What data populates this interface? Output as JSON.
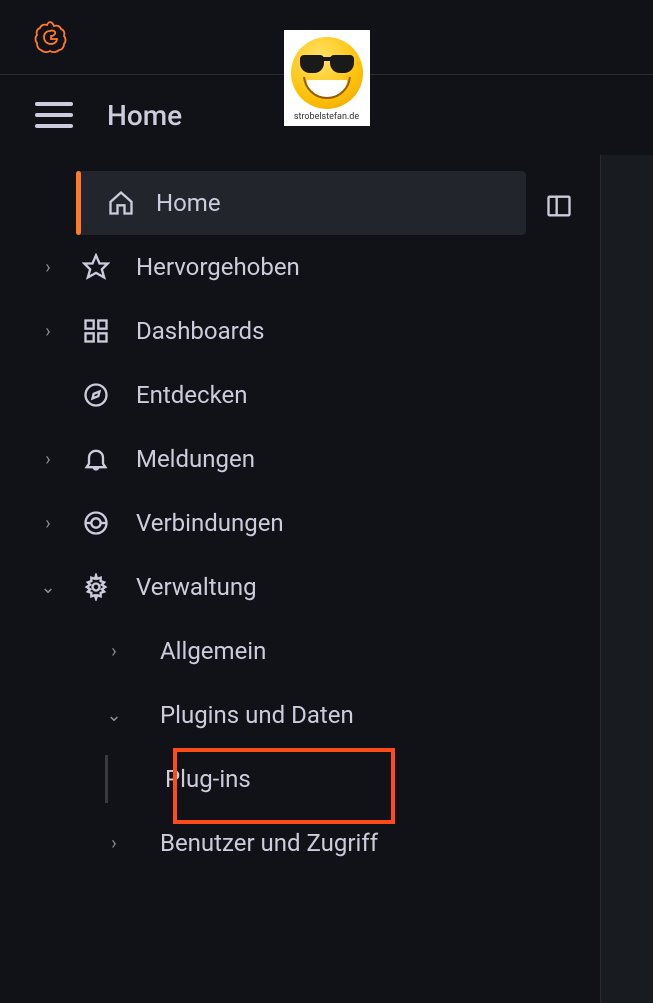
{
  "breadcrumb": {
    "title": "Home"
  },
  "badge": {
    "text": "strobelstefan.de"
  },
  "nav": {
    "home": "Home",
    "starred": "Hervorgehoben",
    "dashboards": "Dashboards",
    "explore": "Entdecken",
    "alerting": "Meldungen",
    "connections": "Verbindungen",
    "administration": "Verwaltung"
  },
  "admin_sub": {
    "general": "Allgemein",
    "plugins_data": "Plugins und Daten",
    "users_access": "Benutzer und Zugriff"
  },
  "plugins_sub": {
    "plugins": "Plug-ins"
  }
}
